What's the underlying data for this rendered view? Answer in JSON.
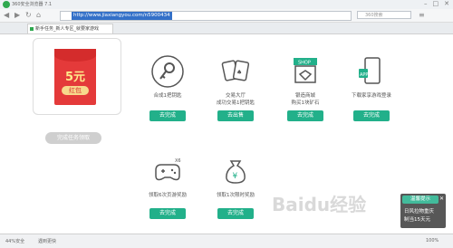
{
  "browser": {
    "title": "360安全浏览器 7.1",
    "url": "http://www.jiaxiangyou.com/n5900434",
    "search_placeholder": "360搜索",
    "tab_label": "新手任务_新人专区_就要家游戏"
  },
  "envelope": {
    "amount": "5元",
    "pill": "红包"
  },
  "claim_button": "完成任务领取",
  "tasks": [
    {
      "label_l1": "合成1把钥匙",
      "label_l2": "",
      "button": "去完成",
      "icon": "key-icon"
    },
    {
      "label_l1": "交易大厅",
      "label_l2": "成功交易1把钥匙",
      "button": "去出售",
      "icon": "cards-icon"
    },
    {
      "label_l1": "银造商城",
      "label_l2": "购买1块矿石",
      "button": "去完成",
      "icon": "shop-icon"
    },
    {
      "label_l1": "下载家享游戏登录",
      "label_l2": "",
      "button": "去完成",
      "icon": "app-icon"
    },
    {
      "label_l1": "领取6次页游奖励",
      "label_l2": "",
      "button": "去完成",
      "icon": "gamepad-icon"
    },
    {
      "label_l1": "领取1次限时奖励",
      "label_l2": "",
      "button": "去完成",
      "icon": "moneybag-icon"
    }
  ],
  "gamepad_badge": "X6",
  "shop_badge": "SHOP",
  "status": {
    "left": "44%安全",
    "mid": "遇到更快",
    "zoom": "100%"
  },
  "promo": {
    "head": "温馨提示",
    "l1": "日风拉物重庆",
    "l2": "制当15天元"
  },
  "watermark": "Baidu经验"
}
